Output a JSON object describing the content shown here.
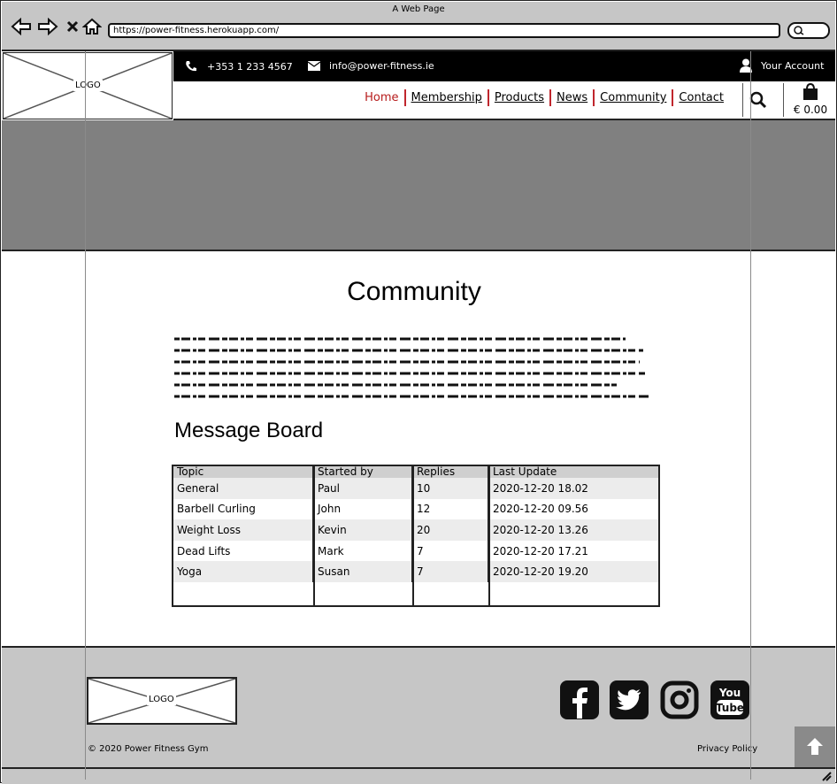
{
  "browser": {
    "window_title": "A Web Page",
    "url": "https://power-fitness.herokuapp.com/"
  },
  "header": {
    "logo_label": "LOGO",
    "phone": "+353 1 233 4567",
    "email": "info@power-fitness.ie",
    "account_label": "Your Account",
    "nav": [
      "Home",
      "Membership",
      "Products",
      "News",
      "Community",
      "Contact"
    ],
    "cart_total": "€ 0.00"
  },
  "main": {
    "title": "Community",
    "section_title": "Message Board",
    "table": {
      "columns": [
        "Topic",
        "Started by",
        "Replies",
        "Last Update"
      ],
      "rows": [
        [
          "General",
          "Paul",
          "10",
          "2020-12-20 18.02"
        ],
        [
          "Barbell Curling",
          "John",
          "12",
          "2020-12-20 09.56"
        ],
        [
          "Weight Loss",
          "Kevin",
          "20",
          "2020-12-20 13.26"
        ],
        [
          "Dead Lifts",
          "Mark",
          "7",
          "2020-12-20 17.21"
        ],
        [
          "Yoga",
          "Susan",
          "7",
          "2020-12-20 19.20"
        ]
      ]
    }
  },
  "footer": {
    "logo_label": "LOGO",
    "social_icons": [
      "facebook-icon",
      "twitter-icon",
      "instagram-icon",
      "youtube-icon"
    ],
    "copyright": "© 2020 Power Fitness Gym",
    "privacy": "Privacy Policy"
  },
  "colors": {
    "accent": "#b71c1c",
    "hero": "#808080",
    "chrome": "#c6c6c6"
  }
}
